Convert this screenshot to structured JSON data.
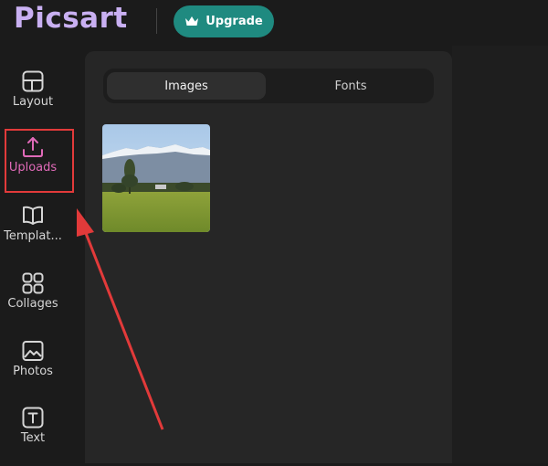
{
  "header": {
    "logo_text": "Picsart",
    "upgrade_label": "Upgrade"
  },
  "sidebar": {
    "items": [
      {
        "label": "Layout",
        "icon": "layout-icon"
      },
      {
        "label": "Uploads",
        "icon": "upload-icon",
        "active": true
      },
      {
        "label": "Templat...",
        "icon": "book-icon"
      },
      {
        "label": "Collages",
        "icon": "collage-grid-icon"
      },
      {
        "label": "Photos",
        "icon": "photo-icon"
      },
      {
        "label": "Text",
        "icon": "text-icon"
      }
    ]
  },
  "panel": {
    "tabs": [
      {
        "label": "Images",
        "active": true
      },
      {
        "label": "Fonts",
        "active": false
      }
    ]
  },
  "colors": {
    "background": "#1b1b1b",
    "panel": "#262626",
    "accent_teal": "#1f8a80",
    "logo_purple": "#c9b0f2",
    "active_pink": "#e06ab8",
    "annotation_red": "#e23a3a"
  }
}
